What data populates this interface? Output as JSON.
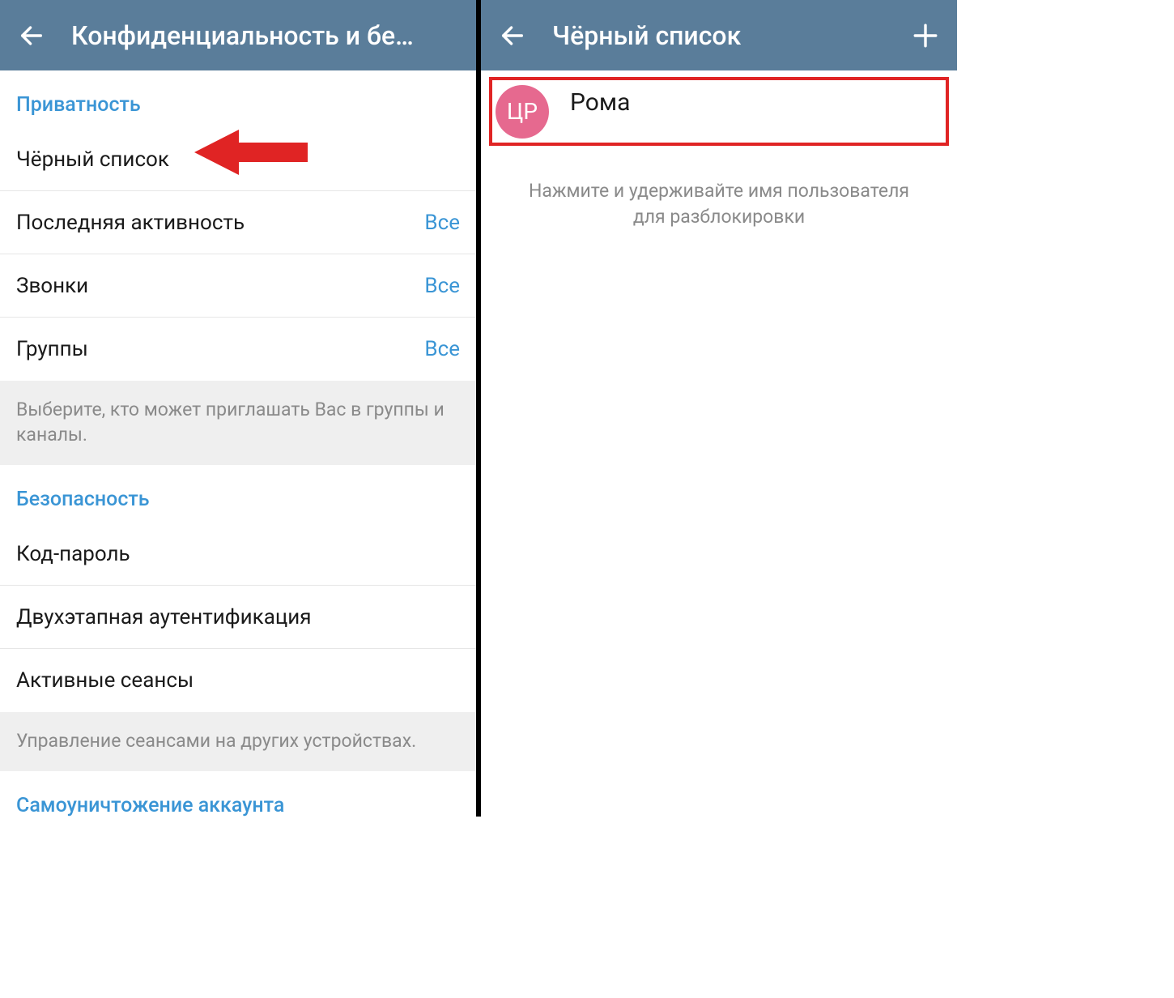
{
  "left_panel": {
    "header_title": "Конфиденциальность и бе…",
    "privacy_section": {
      "header": "Приватность",
      "blocklist_label": "Чёрный список",
      "last_seen": {
        "label": "Последняя активность",
        "value": "Все"
      },
      "calls": {
        "label": "Звонки",
        "value": "Все"
      },
      "groups": {
        "label": "Группы",
        "value": "Все"
      },
      "groups_footer": "Выберите, кто может приглашать Вас в группы и каналы."
    },
    "security_section": {
      "header": "Безопасность",
      "passcode_label": "Код-пароль",
      "two_step_label": "Двухэтапная аутентификация",
      "sessions_label": "Активные сеансы",
      "sessions_footer": "Управление сеансами на других устройствах."
    },
    "self_destruct_section": {
      "header": "Самоуничтожение аккаунта"
    }
  },
  "right_panel": {
    "header_title": "Чёрный список",
    "blocked_users": [
      {
        "initials": "ЦР",
        "name": "Рома"
      }
    ],
    "hint": "Нажмите и удерживайте имя пользователя для разблокировки"
  },
  "colors": {
    "header_bg": "#5a7d9a",
    "accent_blue": "#3a95d5",
    "arrow_red": "#e02424",
    "avatar_pink": "#e6698f"
  }
}
